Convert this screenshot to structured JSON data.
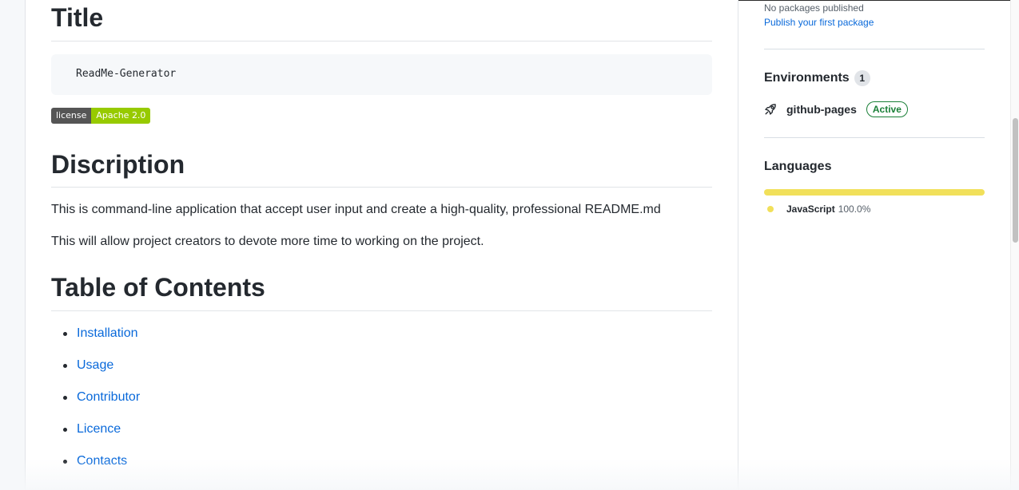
{
  "readme": {
    "title_heading": "Title",
    "code_block": "ReadMe-Generator",
    "badge": {
      "label": "license",
      "value": "Apache 2.0",
      "label_color": "#555555",
      "value_color": "#97ca00"
    },
    "description_heading": "Discription",
    "paragraphs": [
      "This is command-line application that accept user input and create a high-quality, professional README.md",
      "This will allow project creators to devote more time to working on the project."
    ],
    "toc_heading": "Table of Contents",
    "toc_items": [
      "Installation",
      "Usage",
      "Contributor",
      "Licence",
      "Contacts"
    ]
  },
  "sidebar": {
    "packages": {
      "empty_text": "No packages published",
      "publish_link": "Publish your first package"
    },
    "environments": {
      "heading": "Environments",
      "count": "1",
      "items": [
        {
          "name": "github-pages",
          "status": "Active",
          "icon": "rocket-icon"
        }
      ]
    },
    "languages": {
      "heading": "Languages",
      "items": [
        {
          "name": "JavaScript",
          "percent": "100.0%",
          "share": 1.0,
          "color": "#f1e05a"
        }
      ]
    }
  },
  "colors": {
    "link": "#0969da",
    "active_green": "#1a7f37"
  }
}
